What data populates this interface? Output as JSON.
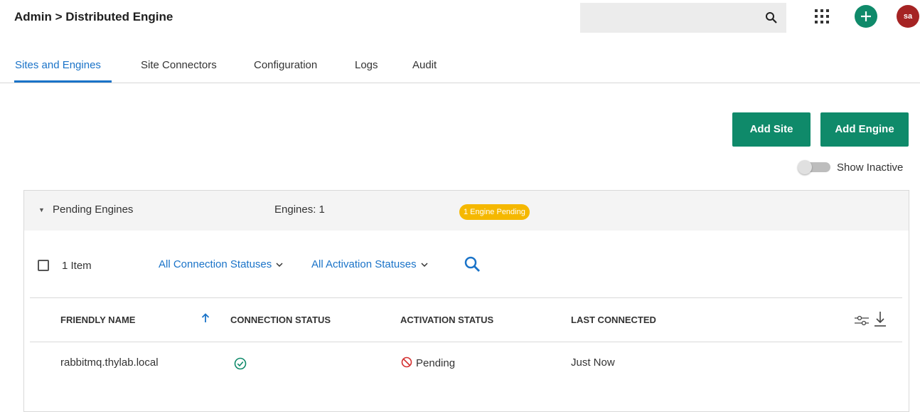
{
  "header": {
    "breadcrumb": "Admin > Distributed Engine",
    "search_placeholder": "",
    "avatar_initials": "sa"
  },
  "tabs": [
    {
      "label": "Sites and Engines",
      "active": true
    },
    {
      "label": "Site Connectors",
      "active": false
    },
    {
      "label": "Configuration",
      "active": false
    },
    {
      "label": "Logs",
      "active": false
    },
    {
      "label": "Audit",
      "active": false
    }
  ],
  "actions": {
    "add_site": "Add Site",
    "add_engine": "Add Engine",
    "show_inactive_label": "Show Inactive",
    "show_inactive_enabled": false
  },
  "panel": {
    "title": "Pending Engines",
    "engines_count": "Engines: 1",
    "badge": "1 Engine Pending",
    "item_count": "1 Item",
    "filters": [
      "All Connection Statuses",
      "All Activation Statuses"
    ],
    "columns": [
      "FRIENDLY NAME",
      "CONNECTION STATUS",
      "ACTIVATION STATUS",
      "LAST CONNECTED"
    ],
    "rows": [
      {
        "friendly_name": "rabbitmq.thylab.local",
        "connection_status": "connected",
        "activation_status": "Pending",
        "last_connected": "Just Now"
      }
    ]
  },
  "colors": {
    "accent": "#1a73c8",
    "primary_button": "#0f8a6a",
    "badge": "#f5b800",
    "avatar": "#a52323",
    "pending_icon": "#d32f2f"
  }
}
